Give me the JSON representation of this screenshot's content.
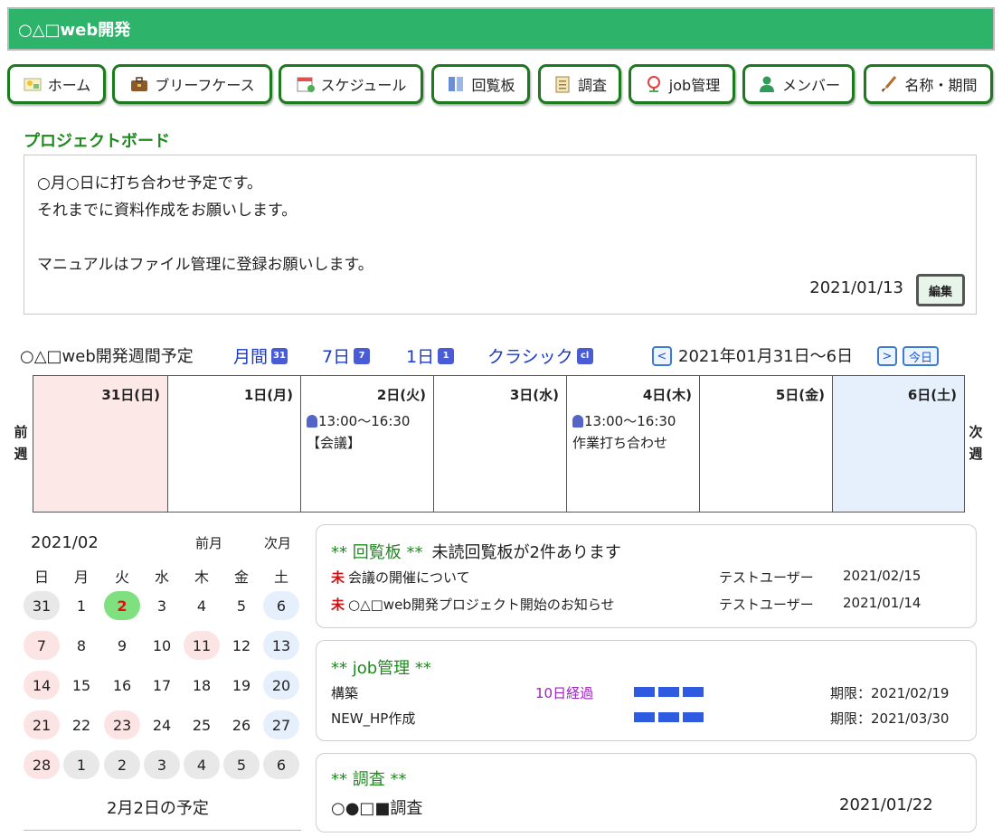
{
  "app_title": "○△□web開発",
  "nav": [
    {
      "label": "ホーム",
      "icon": "home-icon"
    },
    {
      "label": "ブリーフケース",
      "icon": "briefcase-icon"
    },
    {
      "label": "スケジュール",
      "icon": "calendar-icon"
    },
    {
      "label": "回覧板",
      "icon": "bulletin-icon"
    },
    {
      "label": "調査",
      "icon": "clipboard-icon"
    },
    {
      "label": "job管理",
      "icon": "job-icon"
    },
    {
      "label": "メンバー",
      "icon": "member-icon"
    },
    {
      "label": "名称・期間",
      "icon": "brush-icon"
    }
  ],
  "board": {
    "title": "プロジェクトボード",
    "lines": [
      "○月○日に打ち合わせ予定です。",
      "それまでに資料作成をお願いします。",
      "",
      "マニュアルはファイル管理に登録お願いします。"
    ],
    "date": "2021/01/13",
    "edit_label": "編集"
  },
  "weekly": {
    "title": "○△□web開発週間予定",
    "views": [
      {
        "label": "月間",
        "icon_text": "31"
      },
      {
        "label": "7日",
        "icon_text": "7"
      },
      {
        "label": "1日",
        "icon_text": "1"
      },
      {
        "label": "クラシック",
        "icon_text": "cl"
      }
    ],
    "prev_label": "<",
    "next_label": ">",
    "range": "2021年01月31日〜6日",
    "today_label": "今日",
    "prev_week": "前週",
    "next_week": "次週",
    "days": [
      {
        "label": "31日(日)",
        "bg": "#fde8e8",
        "events": []
      },
      {
        "label": "1日(月)",
        "bg": "#ffffff",
        "events": []
      },
      {
        "label": "2日(火)",
        "bg": "#ffffff",
        "events": [
          {
            "time": "13:00〜16:30",
            "title": "【会議】"
          }
        ]
      },
      {
        "label": "3日(水)",
        "bg": "#ffffff",
        "events": []
      },
      {
        "label": "4日(木)",
        "bg": "#ffffff",
        "events": [
          {
            "time": "13:00〜16:30",
            "title": "作業打ち合わせ"
          }
        ]
      },
      {
        "label": "5日(金)",
        "bg": "#ffffff",
        "events": []
      },
      {
        "label": "6日(土)",
        "bg": "#e6f0fc",
        "events": []
      }
    ]
  },
  "minical": {
    "month": "2021/02",
    "prev_label": "前月",
    "next_label": "次月",
    "weekdays": [
      "日",
      "月",
      "火",
      "水",
      "木",
      "金",
      "土"
    ],
    "rows": [
      [
        {
          "d": "31",
          "s": "gray"
        },
        {
          "d": "1",
          "s": ""
        },
        {
          "d": "2",
          "s": "today"
        },
        {
          "d": "3",
          "s": ""
        },
        {
          "d": "4",
          "s": ""
        },
        {
          "d": "5",
          "s": ""
        },
        {
          "d": "6",
          "s": "blue"
        }
      ],
      [
        {
          "d": "7",
          "s": "pink"
        },
        {
          "d": "8",
          "s": ""
        },
        {
          "d": "9",
          "s": ""
        },
        {
          "d": "10",
          "s": ""
        },
        {
          "d": "11",
          "s": "pink"
        },
        {
          "d": "12",
          "s": ""
        },
        {
          "d": "13",
          "s": "blue"
        }
      ],
      [
        {
          "d": "14",
          "s": "pink"
        },
        {
          "d": "15",
          "s": ""
        },
        {
          "d": "16",
          "s": ""
        },
        {
          "d": "17",
          "s": ""
        },
        {
          "d": "18",
          "s": ""
        },
        {
          "d": "19",
          "s": ""
        },
        {
          "d": "20",
          "s": "blue"
        }
      ],
      [
        {
          "d": "21",
          "s": "pink"
        },
        {
          "d": "22",
          "s": ""
        },
        {
          "d": "23",
          "s": "pink"
        },
        {
          "d": "24",
          "s": ""
        },
        {
          "d": "25",
          "s": ""
        },
        {
          "d": "26",
          "s": ""
        },
        {
          "d": "27",
          "s": "blue"
        }
      ],
      [
        {
          "d": "28",
          "s": "pink"
        },
        {
          "d": "1",
          "s": "gray"
        },
        {
          "d": "2",
          "s": "gray"
        },
        {
          "d": "3",
          "s": "gray"
        },
        {
          "d": "4",
          "s": "gray"
        },
        {
          "d": "5",
          "s": "gray"
        },
        {
          "d": "6",
          "s": "gray"
        }
      ]
    ],
    "schedule_title": "2月2日の予定"
  },
  "bulletin": {
    "title": "** 回覧板 **",
    "subtitle": "未読回覧板が2件あります",
    "unread_mark": "未",
    "items": [
      {
        "title": "会議の開催について",
        "user": "テストユーザー",
        "date": "2021/02/15"
      },
      {
        "title": "○△□web開発プロジェクト開始のお知らせ",
        "user": "テストユーザー",
        "date": "2021/01/14"
      }
    ]
  },
  "jobs": {
    "title": "** job管理 **",
    "items": [
      {
        "name": "構築",
        "status": "10日経過",
        "progress_blocks": 3,
        "deadline": "期限：2021/02/19"
      },
      {
        "name": "NEW_HP作成",
        "status": "",
        "progress_blocks": 3,
        "deadline": "期限：2021/03/30"
      }
    ]
  },
  "survey": {
    "title": "** 調査 **",
    "item": {
      "name": "○●□■調査",
      "date": "2021/01/22"
    }
  },
  "colors": {
    "header_green": "#2db36a",
    "nav_border": "#1e7a1e",
    "link_blue": "#1a3bc6",
    "status_purple": "#a020c0",
    "progress_blue": "#2f5be0"
  }
}
